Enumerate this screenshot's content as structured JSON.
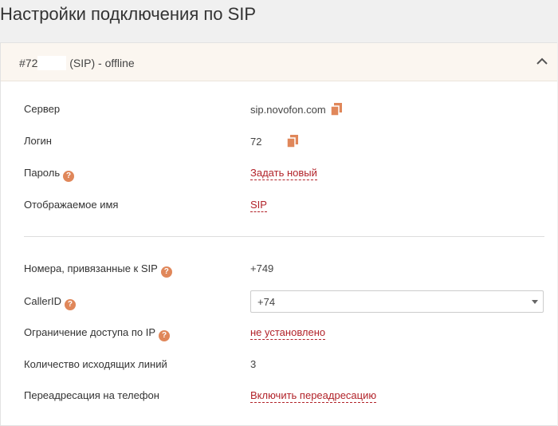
{
  "page": {
    "title": "Настройки подключения по SIP"
  },
  "account": {
    "title_prefix": "#72",
    "title_suffix": "(SIP) - offline"
  },
  "icons": {
    "collapse": "chevron-up-icon",
    "copy": "copy-icon",
    "help": "help-icon",
    "dropdown": "caret-down-icon"
  },
  "colors": {
    "accent": "#b2232a",
    "help": "#e0875a",
    "copy": "#e0875a",
    "header_bg": "#fbf6f0"
  },
  "fields": {
    "server": {
      "label": "Сервер",
      "value": "sip.novofon.com"
    },
    "login": {
      "label": "Логин",
      "value": "72"
    },
    "password": {
      "label": "Пароль",
      "help": "?",
      "action": "Задать новый"
    },
    "display_name": {
      "label": "Отображаемое имя",
      "value": "SIP"
    },
    "numbers": {
      "label": "Номера, привязанные к SIP",
      "help": "?",
      "value": "+749"
    },
    "caller_id": {
      "label": "CallerID",
      "help": "?",
      "value": "+74"
    },
    "ip_restriction": {
      "label": "Ограничение доступа по IP",
      "help": "?",
      "value": "не установлено"
    },
    "outgoing_lines": {
      "label": "Количество исходящих линий",
      "value": "3"
    },
    "forwarding": {
      "label": "Переадресация на телефон",
      "action": "Включить переадресацию"
    }
  }
}
